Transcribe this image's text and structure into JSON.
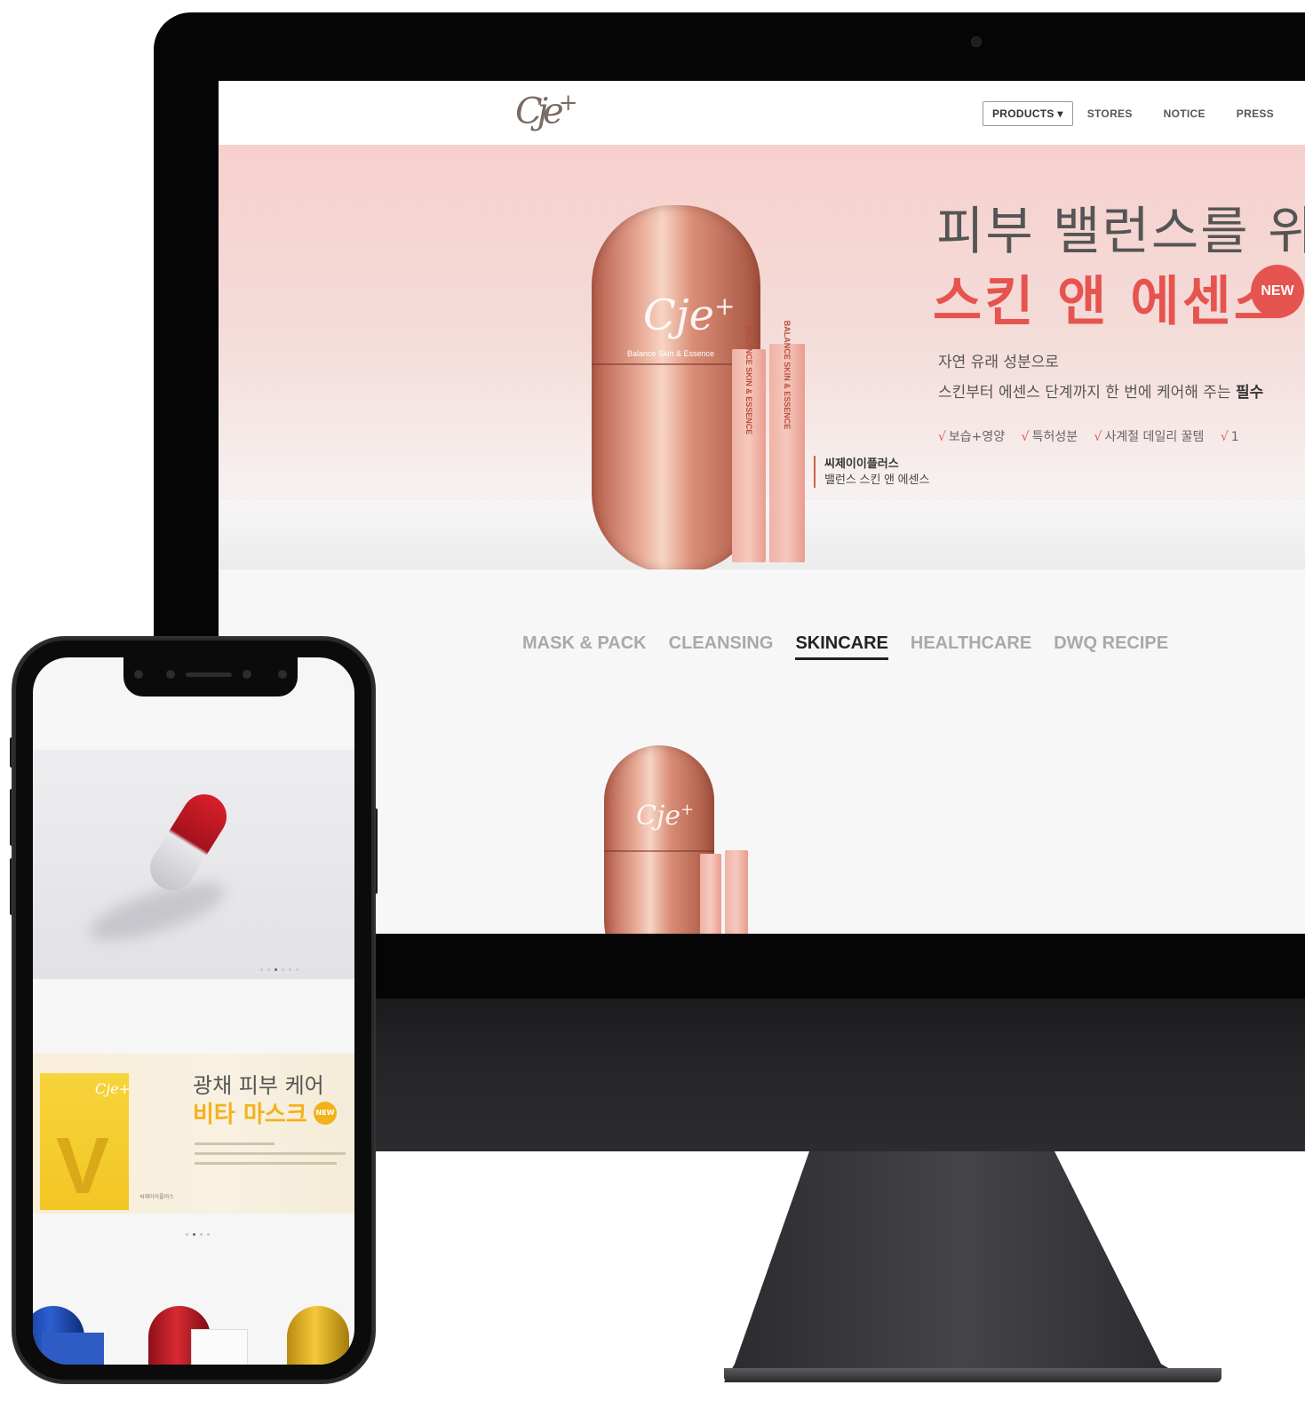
{
  "desktop": {
    "logo": "Cje+",
    "nav": [
      {
        "label": "PRODUCTS",
        "has_dropdown": true
      },
      {
        "label": "STORES"
      },
      {
        "label": "NOTICE"
      },
      {
        "label": "PRESS"
      }
    ],
    "hero": {
      "title_line1": "피부 밸런스를 위한",
      "title_line2": "스킨 앤 에센스",
      "badge": "NEW",
      "desc_line1": "자연 유래 성분으로",
      "desc_line2": "스킨부터 에센스 단계까지 한 번에 케어해 주는",
      "desc_line2_bold": "필수",
      "tags": [
        "보습+영양",
        "특허성분",
        "사계절 데일리 꿀템",
        "1"
      ],
      "caption_brand": "씨제이이플러스",
      "caption_product": "밸런스 스킨 앤 에센스",
      "capsule_text": "Balance Skin & Essence",
      "stick_text": "BALANCE SKIN & ESSENCE"
    },
    "categories": [
      {
        "label": "MASK & PACK",
        "active": false
      },
      {
        "label": "CLEANSING",
        "active": false
      },
      {
        "label": "SKINCARE",
        "active": true
      },
      {
        "label": "HEALTHCARE",
        "active": false
      },
      {
        "label": "DWQ RECIPE",
        "active": false
      }
    ],
    "colors": {
      "accent": "#e6544f",
      "copper": "#d98d76"
    }
  },
  "mobile": {
    "banner": {
      "title_line1": "광채 피부 케어",
      "title_line2": "비타 마스크",
      "badge": "NEW",
      "caption": "씨제이이플러스"
    },
    "colors": {
      "pill_red": "#c4161f",
      "vita_yellow": "#f3b21b"
    }
  }
}
